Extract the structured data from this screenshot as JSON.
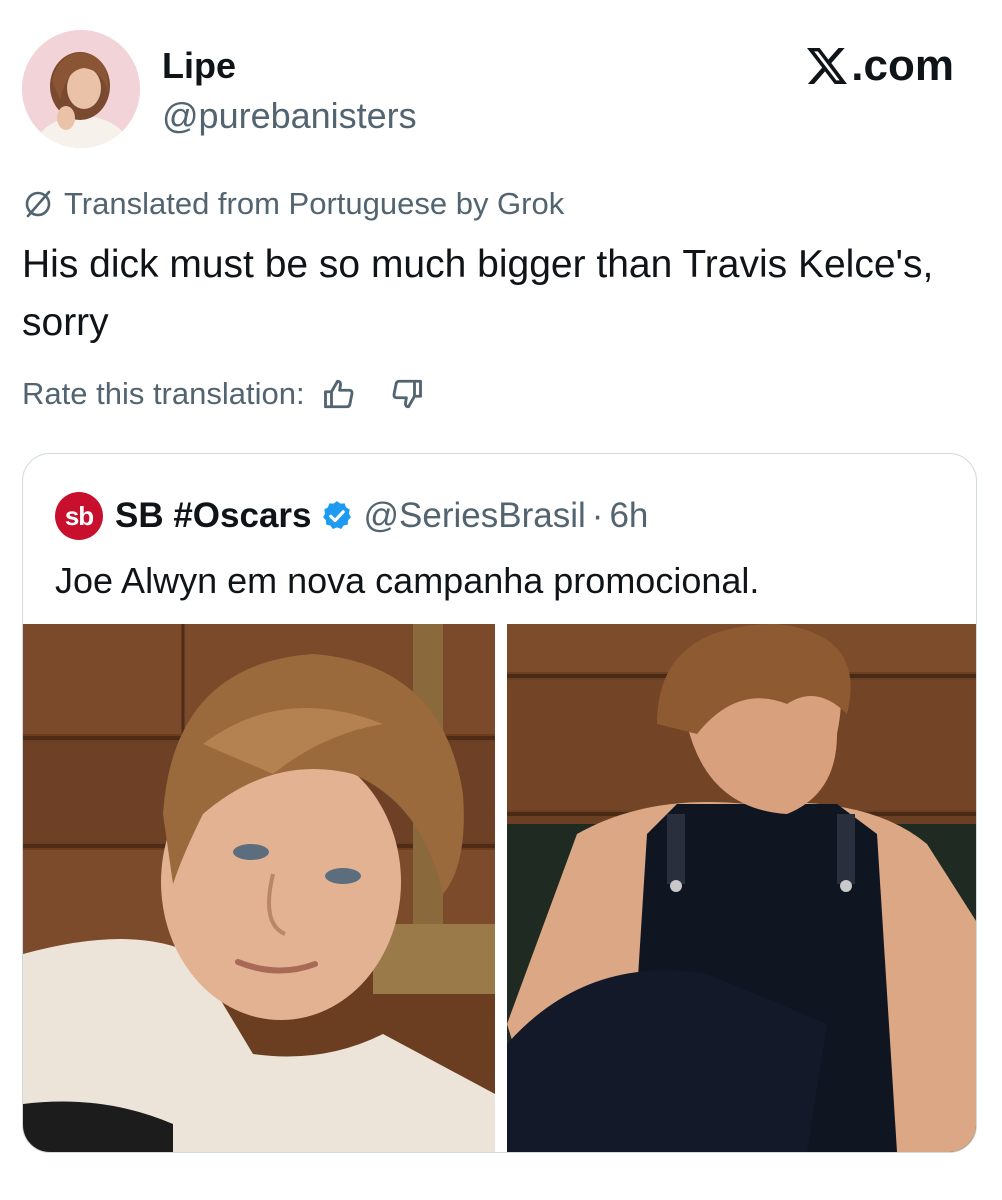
{
  "tweet": {
    "display_name": "Lipe",
    "handle": "@purebanisters",
    "avatar_icon": "profile-photo",
    "brand": {
      "logo_icon": "x-logo-icon",
      "text": ".com"
    },
    "translation_notice": "Translated from Portuguese by Grok",
    "text": "His dick must be so much bigger than Travis Kelce's, sorry",
    "rate_label": "Rate this translation:"
  },
  "quote": {
    "logo_text": "sb",
    "logo_color": "#c8102e",
    "display_name": "SB #Oscars",
    "verified": true,
    "verified_color": "#1d9bf0",
    "handle": "@SeriesBrasil",
    "separator": "·",
    "time": "6h",
    "text": "Joe Alwyn em nova campanha promocional.",
    "media": [
      {
        "kind": "photo"
      },
      {
        "kind": "photo"
      }
    ]
  },
  "colors": {
    "text_primary": "#0f1419",
    "text_secondary": "#536471",
    "border": "#cfd9de"
  }
}
